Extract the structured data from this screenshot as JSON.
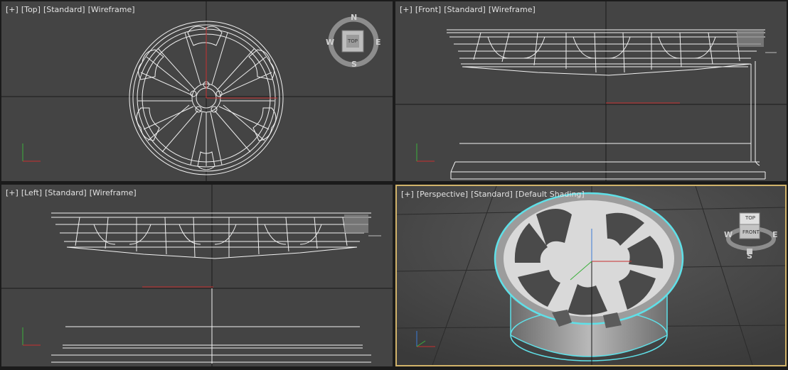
{
  "viewports": [
    {
      "id": "top",
      "labels": [
        "[+]",
        "[Top]",
        "[Standard]",
        "[Wireframe]"
      ],
      "active": false
    },
    {
      "id": "front",
      "labels": [
        "[+]",
        "[Front]",
        "[Standard]",
        "[Wireframe]"
      ],
      "active": false
    },
    {
      "id": "left",
      "labels": [
        "[+]",
        "[Left]",
        "[Standard]",
        "[Wireframe]"
      ],
      "active": false
    },
    {
      "id": "perspective",
      "labels": [
        "[+]",
        "[Perspective]",
        "[Standard]",
        "[Default Shading]"
      ],
      "active": true
    }
  ],
  "viewcube": {
    "top": {
      "face": "TOP",
      "n": "N",
      "s": "S",
      "e": "E",
      "w": "W"
    },
    "perspective": {
      "face": "TOP",
      "face2": "FRONT",
      "s": "S",
      "e": "E",
      "w": "W"
    }
  },
  "axes": {
    "x": "x",
    "y": "y",
    "z": "z"
  },
  "colors": {
    "viewport_bg": "#444444",
    "active_border": "#d1b36a",
    "selection": "#5fe0e8",
    "axis_x": "#c83030",
    "axis_y": "#3bb03b",
    "axis_z": "#3a7bd5"
  }
}
